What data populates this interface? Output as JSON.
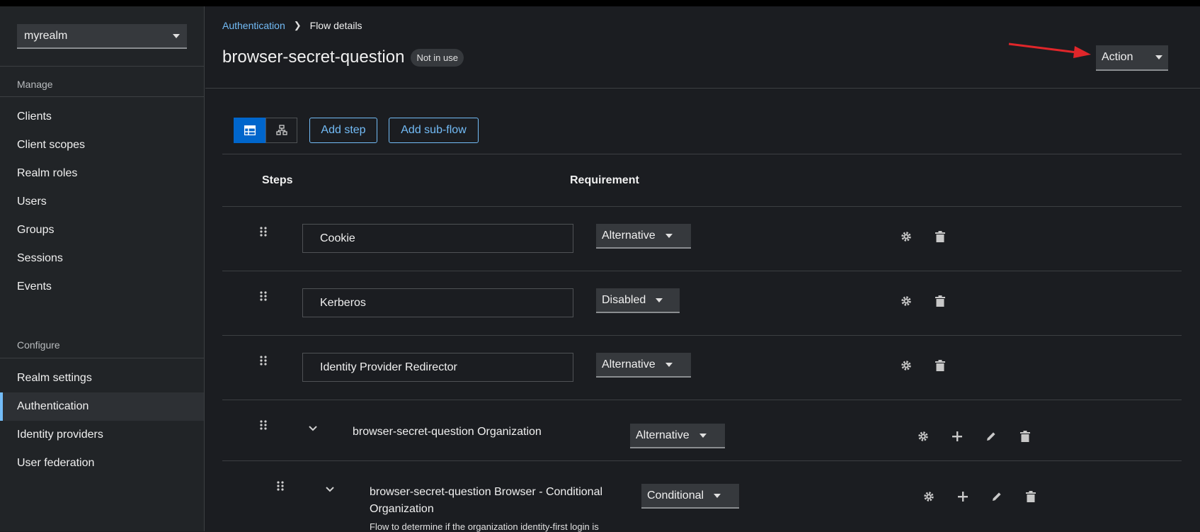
{
  "sidebar": {
    "realm": "myrealm",
    "manage_title": "Manage",
    "manage_items": [
      "Clients",
      "Client scopes",
      "Realm roles",
      "Users",
      "Groups",
      "Sessions",
      "Events"
    ],
    "configure_title": "Configure",
    "configure_items": [
      "Realm settings",
      "Authentication",
      "Identity providers",
      "User federation"
    ],
    "active_item": "Authentication"
  },
  "breadcrumb": {
    "parent": "Authentication",
    "current": "Flow details"
  },
  "header": {
    "title": "browser-secret-question",
    "badge": "Not in use",
    "action_label": "Action"
  },
  "toolbar": {
    "table_view_icon": "table-icon",
    "diagram_view_icon": "diagram-icon",
    "add_step_label": "Add step",
    "add_subflow_label": "Add sub-flow"
  },
  "table": {
    "headers": {
      "steps": "Steps",
      "requirement": "Requirement"
    },
    "rows": [
      {
        "name": "Cookie",
        "requirement": "Alternative",
        "type": "step"
      },
      {
        "name": "Kerberos",
        "requirement": "Disabled",
        "type": "step"
      },
      {
        "name": "Identity Provider Redirector",
        "requirement": "Alternative",
        "type": "step"
      },
      {
        "name": "browser-secret-question Organization",
        "requirement": "Alternative",
        "type": "flow"
      },
      {
        "name_line1": "browser-secret-question Browser - Conditional",
        "name_line2": "Organization",
        "description": "Flow to determine if the organization identity-first login is",
        "requirement": "Conditional",
        "type": "flow"
      }
    ]
  },
  "colors": {
    "accent": "#73bcf7",
    "primary": "#0066cc",
    "annotation_arrow": "#e0262a"
  }
}
